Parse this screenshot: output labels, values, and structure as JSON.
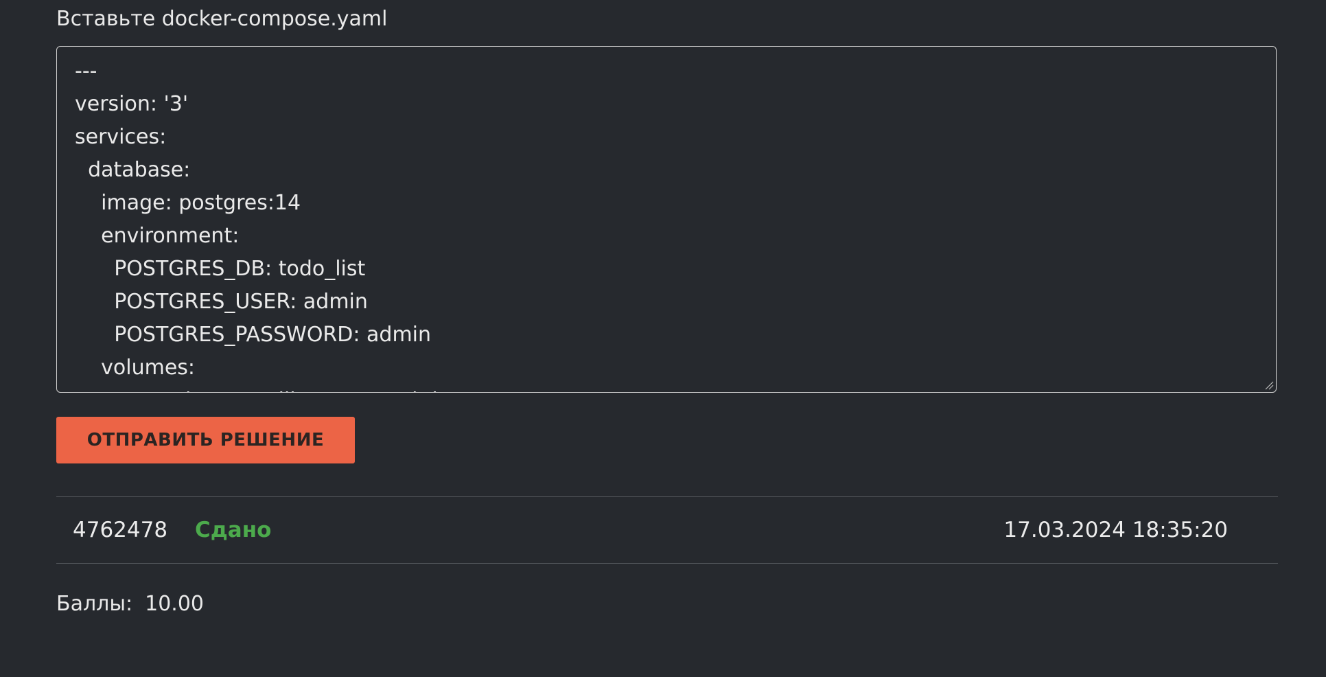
{
  "form": {
    "label": "Вставьте docker-compose.yaml",
    "code": "---\nversion: '3'\nservices:\n  database:\n    image: postgres:14\n    environment:\n      POSTGRES_DB: todo_list\n      POSTGRES_USER: admin\n      POSTGRES_PASSWORD: admin\n    volumes:\n      - ./pg_data:/var/lib/postgresql/data",
    "submit_label": "ОТПРАВИТЬ РЕШЕНИЕ"
  },
  "submission": {
    "id": "4762478",
    "status": "Сдано",
    "timestamp": "17.03.2024 18:35:20",
    "status_color": "#4caa4c"
  },
  "score": {
    "label": "Баллы:",
    "value": "10.00"
  },
  "theme": {
    "background": "#26292e",
    "accent": "#ec6446"
  }
}
